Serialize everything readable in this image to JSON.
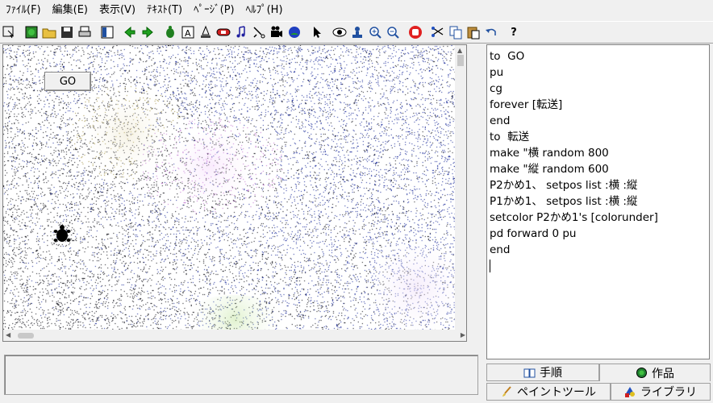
{
  "menu": [
    {
      "label": "ﾌｧｲﾙ(F)",
      "name": "menu-file"
    },
    {
      "label": "編集(E)",
      "name": "menu-edit"
    },
    {
      "label": "表示(V)",
      "name": "menu-view"
    },
    {
      "label": "ﾃｷｽﾄ(T)",
      "name": "menu-text"
    },
    {
      "label": "ﾍﾟｰｼﾞ(P)",
      "name": "menu-page"
    },
    {
      "label": "ﾍﾙﾌﾟ(H)",
      "name": "menu-help"
    }
  ],
  "toolbar": {
    "help_label": "?"
  },
  "canvas": {
    "go_button_label": "GO"
  },
  "editor": {
    "lines": [
      "to  GO",
      "pu",
      "cg",
      "forever [転送]",
      "end",
      "to  転送",
      "make \"横 random 800",
      "make \"縦 random 600",
      "P2かめ1、 setpos list :横 :縦",
      "P1かめ1、 setpos list :横 :縦",
      "setcolor P2かめ1's [colorunder]",
      "pd forward 0 pu",
      "end"
    ]
  },
  "tabs": {
    "steps": "手順",
    "works": "作品",
    "paint": "ペイントツール",
    "library": "ライブラリ"
  },
  "colors": {
    "noise_blue": "#1a2a9a",
    "noise_black": "#101018",
    "noise_magenta": "#c070d0",
    "noise_olive": "#a09040"
  }
}
